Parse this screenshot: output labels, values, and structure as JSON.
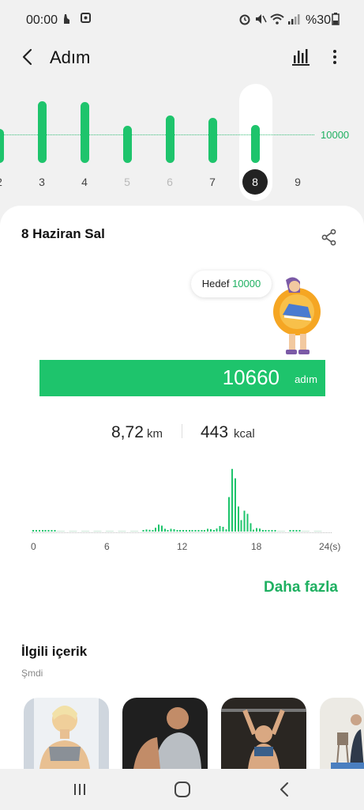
{
  "status_bar": {
    "time": "00:00",
    "battery": "%30"
  },
  "app_bar": {
    "title": "Adım"
  },
  "week_chart": {
    "goal_label": "10000",
    "days": [
      {
        "label": "2",
        "steps": 9600,
        "muted": false,
        "selected": false
      },
      {
        "label": "3",
        "steps": 17500,
        "muted": false,
        "selected": false
      },
      {
        "label": "4",
        "steps": 17200,
        "muted": false,
        "selected": false
      },
      {
        "label": "5",
        "steps": 10500,
        "muted": true,
        "selected": false
      },
      {
        "label": "6",
        "steps": 13500,
        "muted": true,
        "selected": false
      },
      {
        "label": "7",
        "steps": 12800,
        "muted": false,
        "selected": false
      },
      {
        "label": "8",
        "steps": 10660,
        "muted": false,
        "selected": true
      },
      {
        "label": "9",
        "steps": 0,
        "muted": false,
        "selected": false
      }
    ]
  },
  "summary": {
    "date": "8 Haziran Sal",
    "goal_prefix": "Hedef",
    "goal_value": "10000",
    "steps": "10660",
    "steps_unit": "adım",
    "distance": "8,72",
    "distance_unit": "km",
    "calories": "443",
    "calories_unit": "kcal"
  },
  "hourly_chart": {
    "ticks": [
      "0",
      "6",
      "12",
      "18",
      "24(s)"
    ],
    "values": [
      0.02,
      0.02,
      0,
      0,
      0,
      0,
      0,
      0,
      0,
      0.03,
      0.1,
      0.04,
      0.01,
      0.02,
      0.04,
      0.08,
      0.9,
      0.3,
      0.05,
      0.01,
      0,
      0.02,
      0,
      0
    ]
  },
  "more_label": "Daha fazla",
  "related": {
    "title": "İlgili içerik",
    "subtitle": "Şmdi"
  },
  "colors": {
    "accent": "#1ec46c",
    "accent_text": "#1fb061"
  }
}
